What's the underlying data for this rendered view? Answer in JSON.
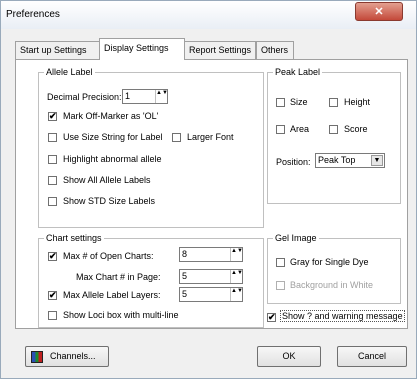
{
  "window": {
    "title": "Preferences",
    "close_glyph": "✕"
  },
  "tabs": [
    {
      "label": "Start up Settings"
    },
    {
      "label": "Display Settings"
    },
    {
      "label": "Report Settings"
    },
    {
      "label": "Others"
    }
  ],
  "allele_label": {
    "legend": "Allele Label",
    "precision_label": "Decimal Precision:",
    "precision_value": "1",
    "mark_off_marker": "Mark Off-Marker as 'OL'",
    "use_size_string": "Use Size String for Label",
    "larger_font": "Larger Font",
    "highlight_abnormal": "Highlight abnormal allele",
    "show_all_allele": "Show All Allele Labels",
    "show_std_size": "Show STD Size Labels"
  },
  "peak_label": {
    "legend": "Peak Label",
    "size": "Size",
    "height": "Height",
    "area": "Area",
    "score": "Score",
    "position_label": "Position:",
    "position_value": "Peak Top"
  },
  "chart_settings": {
    "legend": "Chart settings",
    "max_open_charts_label": "Max # of Open Charts:",
    "max_open_charts_value": "8",
    "max_chart_in_page_label": "Max Chart # in Page:",
    "max_chart_in_page_value": "5",
    "max_allele_layers_label": "Max Allele Label Layers:",
    "max_allele_layers_value": "5",
    "show_loci_box": "Show Loci box with multi-line"
  },
  "gel_image": {
    "legend": "Gel Image",
    "gray_single_dye": "Gray for Single Dye",
    "background_white": "Background in White"
  },
  "show_warning": "Show ? and warning message",
  "buttons": {
    "channels": "Channels...",
    "ok": "OK",
    "cancel": "Cancel"
  },
  "checkmark": "✔",
  "spin_arrows": "▲▼",
  "dropdown_arrow": "▼"
}
